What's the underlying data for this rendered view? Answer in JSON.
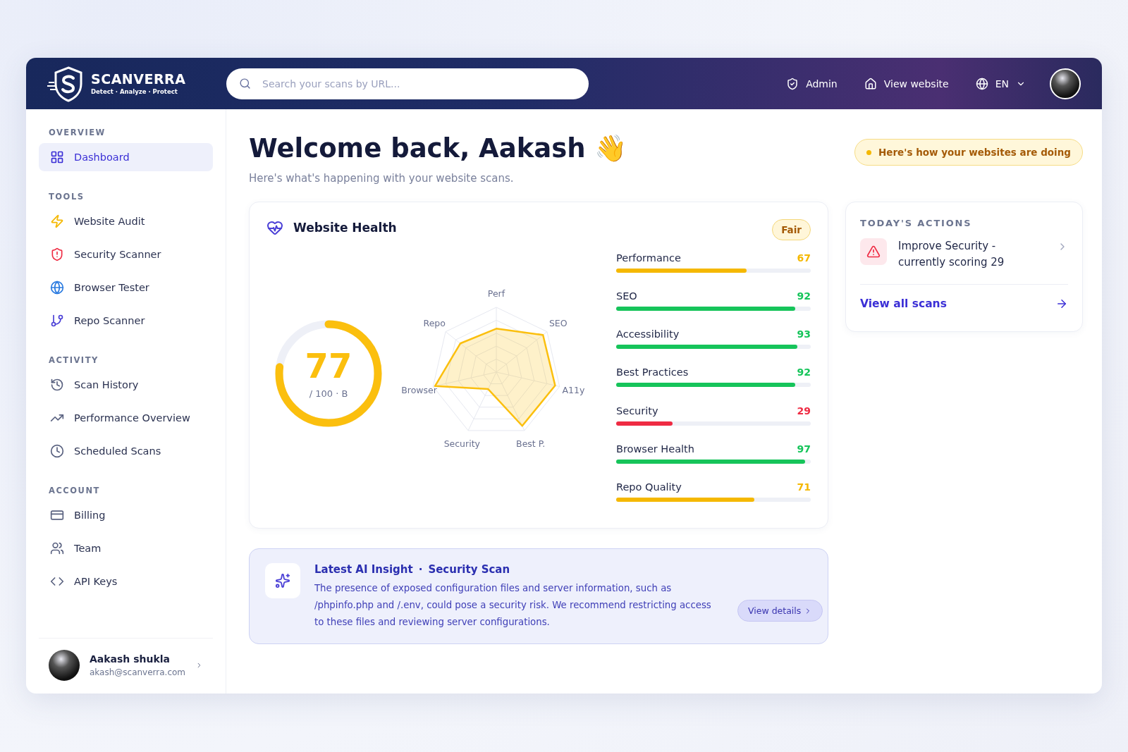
{
  "brand": {
    "name": "SCANVERRA",
    "tagline": "Detect · Analyze · Protect"
  },
  "search": {
    "placeholder": "Search your scans by URL..."
  },
  "header_links": [
    {
      "label": "Admin",
      "kind": "admin"
    },
    {
      "label": "View website",
      "kind": "website"
    }
  ],
  "language": {
    "label": "EN"
  },
  "sidebar": {
    "sections": [
      {
        "title": "OVERVIEW",
        "items": [
          {
            "label": "Dashboard",
            "selected": true
          }
        ]
      },
      {
        "title": "TOOLS",
        "items": [
          {
            "label": "Website Audit",
            "selected": false
          },
          {
            "label": "Security Scanner",
            "selected": false
          },
          {
            "label": "Browser Tester",
            "selected": false
          },
          {
            "label": "Repo Scanner",
            "selected": false
          }
        ]
      },
      {
        "title": "ACTIVITY",
        "items": [
          {
            "label": "Scan History",
            "selected": false
          },
          {
            "label": "Performance Overview",
            "selected": false
          },
          {
            "label": "Scheduled Scans",
            "selected": false
          }
        ]
      },
      {
        "title": "ACCOUNT",
        "items": [
          {
            "label": "Billing",
            "selected": false
          },
          {
            "label": "Team",
            "selected": false
          },
          {
            "label": "API Keys",
            "selected": false
          }
        ]
      }
    ],
    "user": {
      "name": "Aakash shukla",
      "email": "akash@scanverra.com"
    }
  },
  "welcome": {
    "title": "Welcome back, Aakash",
    "emoji": "👋",
    "subtitle": "Here's what's happening with your website scans.",
    "banner": "Here's how your websites are doing"
  },
  "health": {
    "title": "Website Health",
    "badge": "Fair",
    "score": "77",
    "score_caption": "/ 100 · B",
    "radar_axes": [
      "Perf",
      "SEO",
      "A11y",
      "Best P.",
      "Security",
      "Browser",
      "Repo"
    ],
    "metrics": [
      {
        "name": "Performance",
        "value": "67",
        "level": 0.67,
        "color": "#f5b800"
      },
      {
        "name": "SEO",
        "value": "92",
        "level": 0.92,
        "color": "#16c45a"
      },
      {
        "name": "Accessibility",
        "value": "93",
        "level": 0.93,
        "color": "#16c45a"
      },
      {
        "name": "Best Practices",
        "value": "92",
        "level": 0.92,
        "color": "#16c45a"
      },
      {
        "name": "Security",
        "value": "29",
        "level": 0.29,
        "color": "#ef2b43"
      },
      {
        "name": "Browser Health",
        "value": "97",
        "level": 0.97,
        "color": "#16c45a"
      },
      {
        "name": "Repo Quality",
        "value": "71",
        "level": 0.71,
        "color": "#f5b800"
      }
    ]
  },
  "actions": {
    "title": "TODAY'S ACTIONS",
    "items": [
      {
        "text": "Improve Security - currently scoring 29"
      }
    ],
    "link": "View all scans"
  },
  "insight": {
    "title": "Latest AI Insight",
    "separator": "·",
    "topic": "Security Scan",
    "body": "The presence of exposed configuration files and server information, such as /phpinfo.php and /.env, could pose a security risk. We recommend restricting access to these files and reviewing server configurations.",
    "button": "View details"
  }
}
